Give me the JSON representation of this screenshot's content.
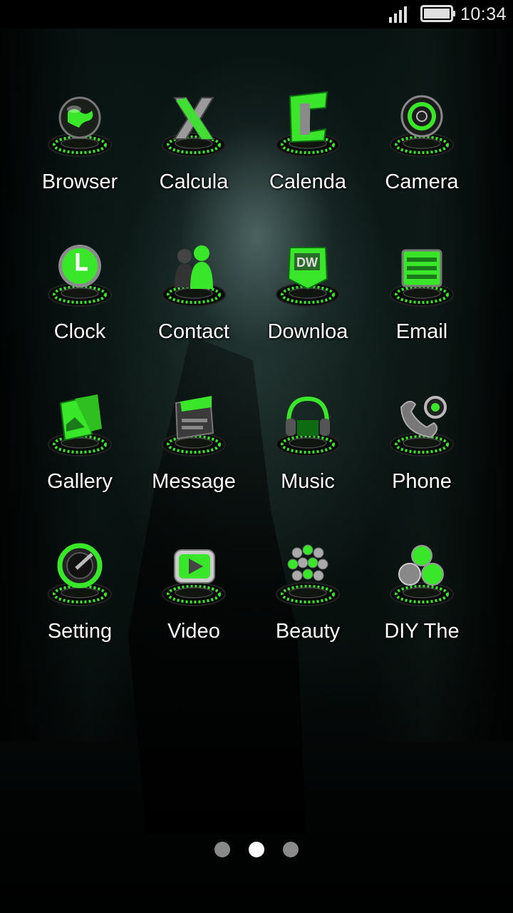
{
  "status_bar": {
    "time": "10:34",
    "icons": [
      "signal-icon",
      "battery-icon"
    ]
  },
  "apps": [
    {
      "label": "Browser",
      "icon": "globe-icon"
    },
    {
      "label": "Calcula",
      "icon": "calculator-icon"
    },
    {
      "label": "Calenda",
      "icon": "calendar-icon"
    },
    {
      "label": "Camera",
      "icon": "camera-icon"
    },
    {
      "label": "Clock",
      "icon": "clock-icon"
    },
    {
      "label": "Contact",
      "icon": "contact-icon"
    },
    {
      "label": "Downloa",
      "icon": "download-icon"
    },
    {
      "label": "Email",
      "icon": "email-icon"
    },
    {
      "label": "Gallery",
      "icon": "gallery-icon"
    },
    {
      "label": "Message",
      "icon": "message-icon"
    },
    {
      "label": "Music",
      "icon": "headphones-icon"
    },
    {
      "label": "Phone",
      "icon": "phone-icon"
    },
    {
      "label": "Setting",
      "icon": "settings-icon"
    },
    {
      "label": "Video",
      "icon": "video-icon"
    },
    {
      "label": "Beauty",
      "icon": "beauty-icon"
    },
    {
      "label": "DIY The",
      "icon": "diy-theme-icon"
    }
  ],
  "page_indicator": {
    "pages": 3,
    "active": 2
  },
  "colors": {
    "accent": "#39e62a",
    "accent_dark": "#0e6b12",
    "label": "#ffffff",
    "dot_inactive": "#8a8a8a",
    "dot_active": "#ffffff"
  }
}
